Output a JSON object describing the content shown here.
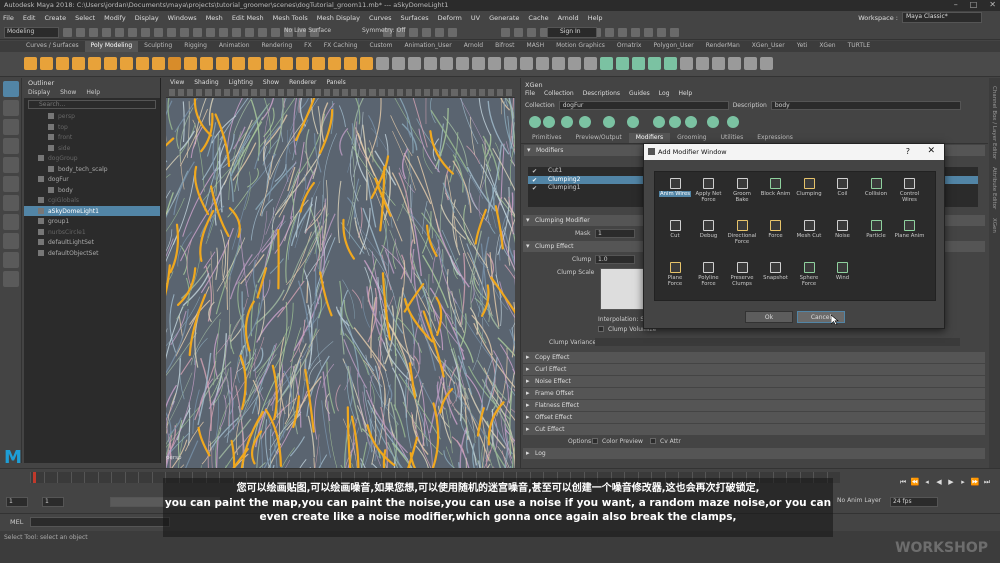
{
  "window": {
    "title": "Autodesk Maya 2018: C:\\Users\\jordan\\Documents\\maya\\projects\\tutorial_groomer\\scenes\\dogTutorial_groom11.mb*  ---  aSkyDomeLight1"
  },
  "menubar": {
    "items": [
      "File",
      "Edit",
      "Create",
      "Select",
      "Modify",
      "Display",
      "Windows",
      "Mesh",
      "Edit Mesh",
      "Mesh Tools",
      "Mesh Display",
      "Curves",
      "Surfaces",
      "Deform",
      "UV",
      "Generate",
      "Cache",
      "Arnold",
      "Help"
    ],
    "workspace_label": "Workspace :",
    "workspace_value": "Maya Classic*"
  },
  "statusline": {
    "mode": "Modeling",
    "live_surface": "No Live Surface",
    "symmetry": "Symmetry: Off",
    "sign_in": "Sign In"
  },
  "shelf": {
    "tabs": [
      "Curves / Surfaces",
      "Poly Modeling",
      "Sculpting",
      "Rigging",
      "Animation",
      "Rendering",
      "FX",
      "FX Caching",
      "Custom",
      "Animation_User",
      "Arnold",
      "Bifrost",
      "MASH",
      "Motion Graphics",
      "Ornatrix",
      "Polygon_User",
      "RenderMan",
      "XGen_User",
      "Yeti",
      "XGen",
      "TURTLE"
    ],
    "active_tab": "Poly Modeling"
  },
  "outliner": {
    "title": "Outliner",
    "menu": [
      "Display",
      "Show",
      "Help"
    ],
    "search_placeholder": "Search...",
    "rows": [
      {
        "label": "persp",
        "dim": true
      },
      {
        "label": "top",
        "dim": true
      },
      {
        "label": "front",
        "dim": true
      },
      {
        "label": "side",
        "dim": true
      },
      {
        "label": "dogGroup",
        "dim": true
      },
      {
        "label": "body_tech_scalp",
        "dim": false
      },
      {
        "label": "dogFur",
        "dim": false
      },
      {
        "label": "body",
        "dim": false
      },
      {
        "label": "cgiGlobals",
        "dim": true
      },
      {
        "label": "aSkyDomeLight1",
        "dim": false,
        "selected": true
      },
      {
        "label": "group1",
        "dim": false
      },
      {
        "label": "nurbsCircle1",
        "dim": true
      },
      {
        "label": "defaultLightSet",
        "dim": false
      },
      {
        "label": "defaultObjectSet",
        "dim": false
      }
    ]
  },
  "viewport": {
    "menu": [
      "View",
      "Shading",
      "Lighting",
      "Show",
      "Renderer",
      "Panels"
    ],
    "camera_label": "persp"
  },
  "xgen": {
    "title": "XGen",
    "menu": [
      "File",
      "Collection",
      "Descriptions",
      "Guides",
      "Log",
      "Help"
    ],
    "collection_label": "Collection",
    "collection_value": "dogFur",
    "description_label": "Description",
    "description_value": "body",
    "tabs": [
      "Primitives",
      "Preview/Output",
      "Modifiers",
      "Grooming",
      "Utilities",
      "Expressions"
    ],
    "active_tab": "Modifiers",
    "modifiers_section": "Modifiers",
    "modifier_list": [
      {
        "label": "Cut1",
        "checked": true,
        "selected": false
      },
      {
        "label": "Clumping2",
        "checked": true,
        "selected": true
      },
      {
        "label": "Clumping1",
        "checked": true,
        "selected": false
      }
    ],
    "clumping_modifier": "Clumping Modifier",
    "mask_label": "Mask",
    "mask_value": "1",
    "clump_effect": "Clump Effect",
    "clump_label": "Clump",
    "clump_value": "1.0",
    "clump_scale_label": "Clump Scale",
    "interpolation_label": "Interpolation",
    "interpolation_value": "Si",
    "clump_volumize": "Clump Volumize",
    "clump_variance": "Clump Variance",
    "collapsed_sections": [
      "Copy Effect",
      "Curl Effect",
      "Noise Effect",
      "Frame Offset",
      "Flatness Effect",
      "Offset Effect",
      "Cut Effect"
    ],
    "options_label": "Options",
    "color_preview": "Color Preview",
    "cv_attr": "Cv Attr",
    "log_label": "Log"
  },
  "dialog": {
    "title": "Add Modifier Window",
    "help_glyph": "?",
    "close_glyph": "✕",
    "modifiers": [
      {
        "label": "Anim Wires",
        "selected": true,
        "color": "#cfcfcf"
      },
      {
        "label": "Apply Net Force",
        "color": "#cfcfcf"
      },
      {
        "label": "Groom Bake",
        "color": "#cfcfcf"
      },
      {
        "label": "Block Anim",
        "color": "#8fd19e"
      },
      {
        "label": "Clumping",
        "color": "#e6c36a"
      },
      {
        "label": "Coil",
        "color": "#cfcfcf"
      },
      {
        "label": "Collision",
        "color": "#8fd19e"
      },
      {
        "label": "Control Wires",
        "color": "#cfcfcf"
      },
      {
        "label": "Cut",
        "color": "#cfcfcf"
      },
      {
        "label": "Debug",
        "color": "#cfcfcf"
      },
      {
        "label": "Directional Force",
        "color": "#e6c36a"
      },
      {
        "label": "Force",
        "color": "#e6c36a"
      },
      {
        "label": "Mesh Cut",
        "color": "#cfcfcf"
      },
      {
        "label": "Noise",
        "color": "#cfcfcf"
      },
      {
        "label": "Particle",
        "color": "#8fd19e"
      },
      {
        "label": "Plane Anim",
        "color": "#8fd19e"
      },
      {
        "label": "Plane Force",
        "color": "#e6c36a"
      },
      {
        "label": "Polyline Force",
        "color": "#cfcfcf"
      },
      {
        "label": "Preserve Clumps",
        "color": "#cfcfcf"
      },
      {
        "label": "Snapshot",
        "color": "#cfcfcf"
      },
      {
        "label": "Sphere Force",
        "color": "#8fd19e"
      },
      {
        "label": "Wind",
        "color": "#8fd19e"
      }
    ],
    "ok_label": "Ok",
    "cancel_label": "Cancel"
  },
  "timeline": {
    "range_start": "1",
    "current_frame": "1",
    "range_end": "120",
    "fps": "24 fps",
    "anim_layer": "No Anim Layer",
    "character_set": "No Character Set"
  },
  "mel": {
    "label": "MEL"
  },
  "helpline": {
    "text": "Select Tool: select an object"
  },
  "subtitle": {
    "zh": "您可以绘画贴图,可以绘画噪音,如果您想,可以使用随机的迷宫噪音,甚至可以创建一个噪音修改器,这也会再次打破锁定,",
    "en_line1": "you can paint the map,you can paint the noise,you can use a noise if you want, a random maze noise,or you can",
    "en_line2": "even create like a noise modifier,which gonna once again also break the clamps,"
  },
  "watermark": {
    "line1": "WORKSHOP"
  },
  "right_sidebar": [
    "Channel Box / Layer Editor",
    "Attribute Editor",
    "XGen"
  ],
  "colors": {
    "selection": "#5285a6",
    "hair_accent": "#f0a81e",
    "maya_logo": "#1d9ed6"
  }
}
